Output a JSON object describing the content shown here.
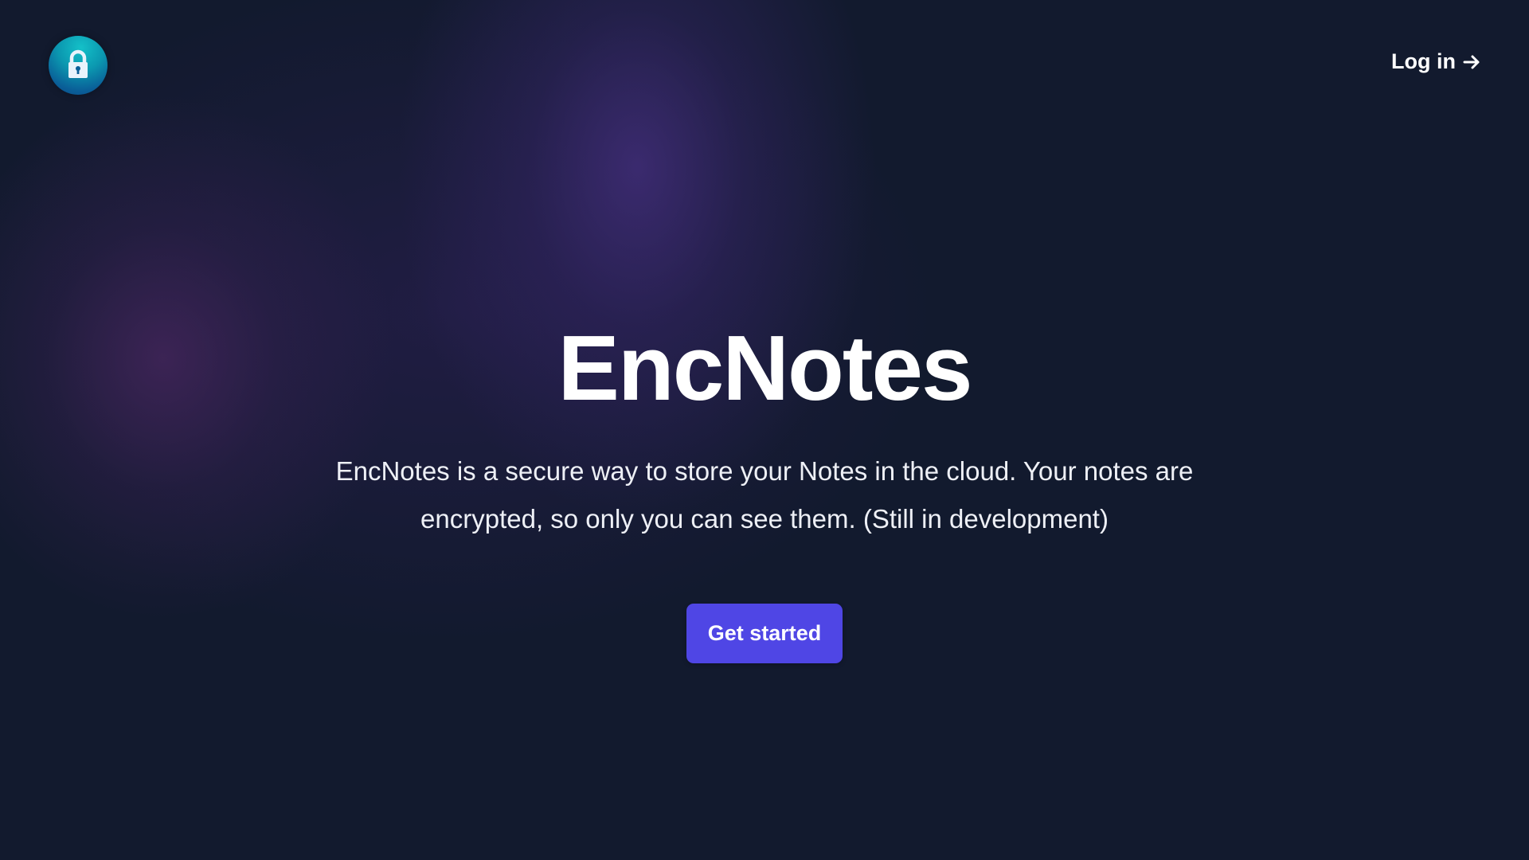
{
  "colors": {
    "background": "#121a2e",
    "accent": "#4f46e5",
    "logo_teal": "#0b98b0"
  },
  "header": {
    "logo_icon": "lock-icon",
    "login_label": "Log in",
    "login_icon": "arrow-right-icon"
  },
  "hero": {
    "title": "EncNotes",
    "description": "EncNotes is a secure way to store your Notes in the cloud. Your notes are encrypted, so only you can see them. (Still in development)",
    "cta_label": "Get started"
  }
}
